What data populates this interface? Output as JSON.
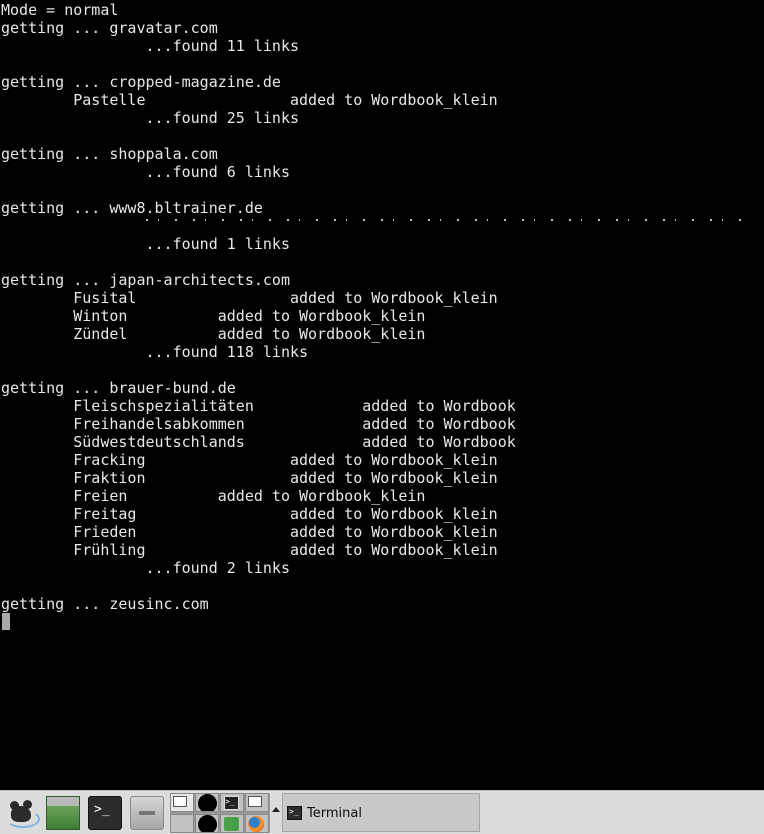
{
  "terminal": {
    "lines": [
      "Mode = normal",
      "getting ... gravatar.com",
      "                ...found 11 links",
      "",
      "getting ... cropped-magazine.de",
      "        Pastelle                added to Wordbook_klein",
      "                ...found 25 links",
      "",
      "getting ... shoppala.com",
      "                ...found 6 links",
      "",
      "getting ... www8.bltrainer.de",
      "",
      "                ...found 1 links",
      "",
      "getting ... japan-architects.com",
      "        Fusital                 added to Wordbook_klein",
      "        Winton          added to Wordbook_klein",
      "        Zündel          added to Wordbook_klein",
      "                ...found 118 links",
      "",
      "getting ... brauer-bund.de",
      "        Fleischspezialitäten            added to Wordbook",
      "        Freihandelsabkommen             added to Wordbook",
      "        Südwestdeutschlands             added to Wordbook",
      "        Fracking                added to Wordbook_klein",
      "        Fraktion                added to Wordbook_klein",
      "        Freien          added to Wordbook_klein",
      "        Freitag                 added to Wordbook_klein",
      "        Frieden                 added to Wordbook_klein",
      "        Frühling                added to Wordbook_klein",
      "                ...found 2 links",
      "",
      "getting ... zeusinc.com"
    ]
  },
  "taskbar": {
    "launchers": {
      "terminal_glyph": ">_"
    },
    "pager": {
      "mini_terminal_glyph": ">_"
    },
    "tasks": [
      {
        "label": "Terminal",
        "icon": "terminal-icon",
        "icon_glyph": ">_"
      }
    ]
  },
  "colors": {
    "terminal_background": "#000000",
    "terminal_text": "#e8e8e8",
    "taskbar_background": "#dcdcdc"
  }
}
